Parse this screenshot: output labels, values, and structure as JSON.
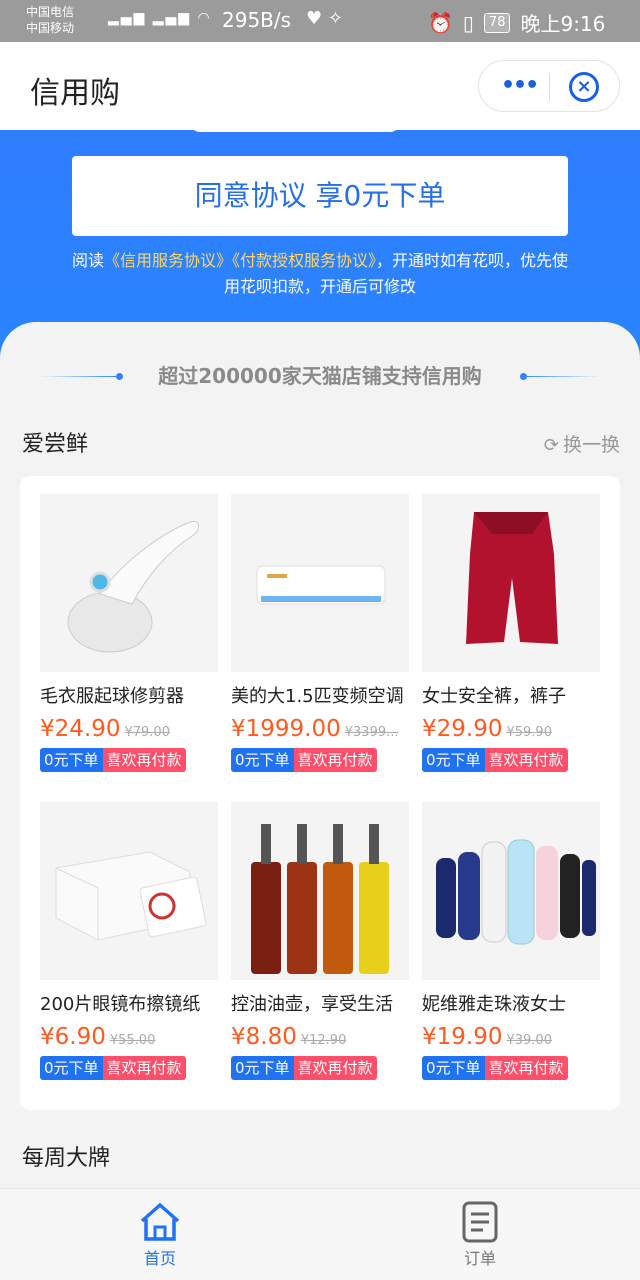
{
  "status_bar": {
    "carrier1": "中国电信",
    "carrier2": "中国移动",
    "net_speed": "295B/s",
    "battery": "78",
    "time": "晚上9:16"
  },
  "header": {
    "title": "信用购"
  },
  "agreement": {
    "button_label": "同意协议 享0元下单",
    "note_prefix": "阅读",
    "link1": "《信用服务协议》",
    "link2": "《付款授权服务协议》",
    "note_suffix": "，开通时如有花呗，优先使用花呗扣款，开通后可修改"
  },
  "banner": {
    "text": "超过200000家天猫店铺支持信用购"
  },
  "section": {
    "title": "爱尝鲜",
    "refresh_label": "换一换"
  },
  "products": [
    {
      "name": "毛衣服起球修剪器",
      "price": "¥24.90",
      "orig_price": "¥79.00",
      "tag1": "0元下单",
      "tag2": "喜欢再付款"
    },
    {
      "name": "美的大1.5匹变频空调",
      "price": "¥1999.00",
      "orig_price": "¥3399...",
      "tag1": "0元下单",
      "tag2": "喜欢再付款"
    },
    {
      "name": "女士安全裤，裤子",
      "price": "¥29.90",
      "orig_price": "¥59.90",
      "tag1": "0元下单",
      "tag2": "喜欢再付款"
    },
    {
      "name": "200片眼镜布擦镜纸",
      "price": "¥6.90",
      "orig_price": "¥55.00",
      "tag1": "0元下单",
      "tag2": "喜欢再付款"
    },
    {
      "name": "控油油壶，享受生活",
      "price": "¥8.80",
      "orig_price": "¥12.90",
      "tag1": "0元下单",
      "tag2": "喜欢再付款"
    },
    {
      "name": "妮维雅走珠液女士",
      "price": "¥19.90",
      "orig_price": "¥39.00",
      "tag1": "0元下单",
      "tag2": "喜欢再付款"
    }
  ],
  "next_section": {
    "title": "每周大牌"
  },
  "bottom_nav": {
    "home": "首页",
    "orders": "订单"
  },
  "colors": {
    "primary_blue": "#2a85ff",
    "price_orange": "#ff5a1f",
    "tag_blue": "#1f72f2",
    "tag_red": "#ff4f6a"
  }
}
